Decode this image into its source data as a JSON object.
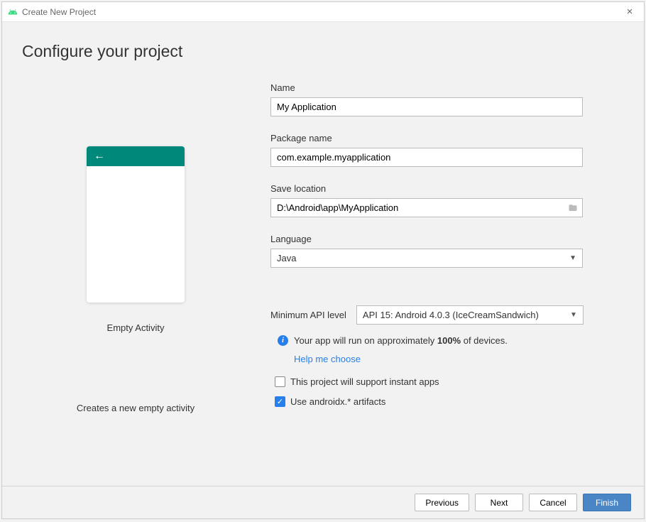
{
  "window": {
    "title": "Create New Project"
  },
  "header": {
    "title": "Configure your project"
  },
  "preview": {
    "template_name": "Empty Activity",
    "template_desc": "Creates a new empty activity"
  },
  "form": {
    "name_label": "Name",
    "name_value": "My Application",
    "package_label": "Package name",
    "package_value": "com.example.myapplication",
    "save_label": "Save location",
    "save_value": "D:\\Android\\app\\MyApplication",
    "language_label": "Language",
    "language_value": "Java",
    "api_label": "Minimum API level",
    "api_value": "API 15: Android 4.0.3 (IceCreamSandwich)",
    "info_text_pre": "Your app will run on approximately ",
    "info_text_bold": "100%",
    "info_text_post": " of devices.",
    "help_link": "Help me choose",
    "instant_apps_label": "This project will support instant apps",
    "androidx_label": "Use androidx.* artifacts"
  },
  "footer": {
    "previous": "Previous",
    "next": "Next",
    "cancel": "Cancel",
    "finish": "Finish"
  }
}
